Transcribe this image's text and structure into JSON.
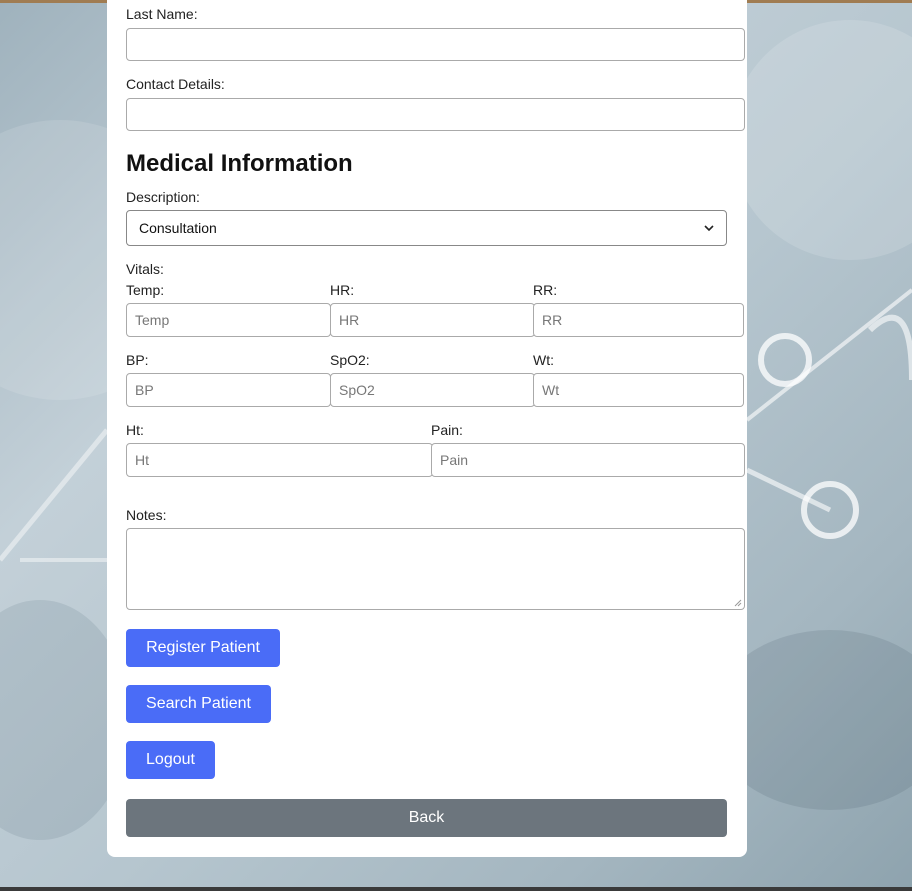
{
  "form": {
    "last_name_label": "Last Name:",
    "contact_label": "Contact Details:",
    "section_title": "Medical Information",
    "description_label": "Description:",
    "description_value": "Consultation",
    "vitals_label": "Vitals:",
    "vitals": {
      "temp": {
        "label": "Temp:",
        "placeholder": "Temp"
      },
      "hr": {
        "label": "HR:",
        "placeholder": "HR"
      },
      "rr": {
        "label": "RR:",
        "placeholder": "RR"
      },
      "bp": {
        "label": "BP:",
        "placeholder": "BP"
      },
      "spo2": {
        "label": "SpO2:",
        "placeholder": "SpO2"
      },
      "wt": {
        "label": "Wt:",
        "placeholder": "Wt"
      },
      "ht": {
        "label": "Ht:",
        "placeholder": "Ht"
      },
      "pain": {
        "label": "Pain:",
        "placeholder": "Pain"
      }
    },
    "notes_label": "Notes:"
  },
  "buttons": {
    "register": "Register Patient",
    "search": "Search Patient",
    "logout": "Logout",
    "back": "Back"
  },
  "colors": {
    "primary": "#4a6cf7",
    "secondary": "#6c757d",
    "card": "#ffffff"
  },
  "icons": {
    "select": "chevron-down-icon",
    "textarea": "resize-grip-icon"
  }
}
